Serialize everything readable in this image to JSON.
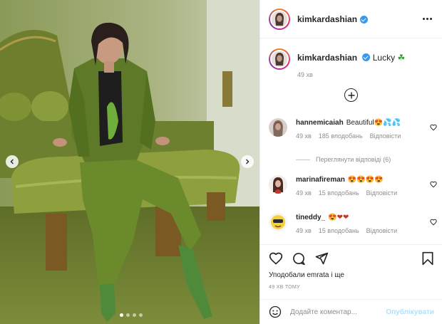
{
  "post": {
    "username": "kimkardashian",
    "carousel_total": 4,
    "carousel_active": 1
  },
  "caption": {
    "username": "kimkardashian",
    "text": "Lucky",
    "emoji": "☘",
    "time": "49 хв"
  },
  "comments": [
    {
      "username": "hannemicaiah",
      "text": "Beautiful😍💦💦",
      "time": "49 хв",
      "likes": "185 вподобань",
      "reply": "Відповісти"
    },
    {
      "username": "marinafireman",
      "text": "😍😍😍😍",
      "time": "49 хв",
      "likes": "15 вподобань",
      "reply": "Відповісти"
    },
    {
      "username": "tineddy_",
      "text": "😍❤❤",
      "time": "49 хв",
      "likes": "15 вподобань",
      "reply": "Відповісти"
    }
  ],
  "view_replies": "Переглянути відповіді (6)",
  "likes_text": "Уподобали emrata і ще",
  "post_time": "49 ХВ ТОМУ",
  "composer": {
    "placeholder": "Додайте коментар...",
    "publish_label": "Опублікувати"
  },
  "colors": {
    "accent": "#3897f0",
    "publish_disabled": "#b2dffc",
    "meta": "#8e8e8e"
  },
  "icons": [
    "more-icon",
    "plus-icon",
    "heart-icon",
    "comment-icon",
    "share-icon",
    "bookmark-icon",
    "emoji-icon",
    "chevron-left-icon",
    "chevron-right-icon"
  ]
}
